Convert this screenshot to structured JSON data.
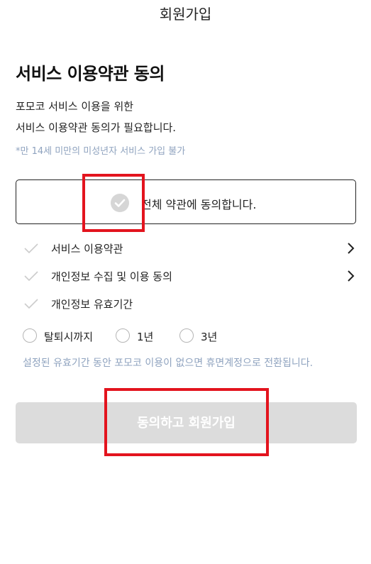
{
  "header": {
    "title": "회원가입"
  },
  "main": {
    "heading": "서비스 이용약관 동의",
    "description_line1": "포모코 서비스 이용을 위한",
    "description_line2": "서비스 이용약관 동의가 필요합니다.",
    "age_note": "*만 14세 미만의 미성년자 서비스 가입 불가",
    "agree_all_label": "전체 약관에 동의합니다.",
    "terms": [
      {
        "label": "서비스 이용약관",
        "icon": "chevron-right-icon"
      },
      {
        "label": "개인정보 수집 및 이용 동의",
        "icon": "chevron-right-icon"
      },
      {
        "label": "개인정보 유효기간"
      }
    ],
    "retention_options": [
      "탈퇴시까지",
      "1년",
      "3년"
    ],
    "retention_note": "설정된 유효기간 동안 포모코 이용이 없으면 휴면계정으로 전환됩니다.",
    "submit_label": "동의하고 회원가입"
  },
  "colors": {
    "highlight_box": "#e3141e",
    "note_text": "#8fa3bf",
    "disabled_button": "#dcdcdc"
  }
}
